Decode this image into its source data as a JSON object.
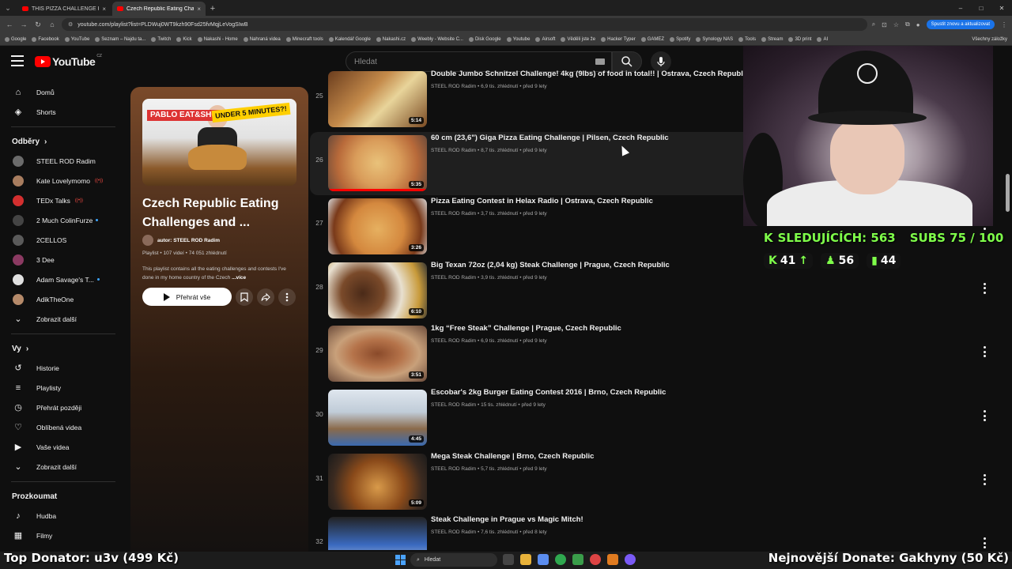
{
  "browser": {
    "tabs": [
      {
        "title": "THIS PIZZA CHALLENGE HAS O"
      },
      {
        "title": "Czech Republic Eating Challeng"
      }
    ],
    "url": "youtube.com/playlist?list=PLDWuj0WT9kzh90Fsd25fvMqjLeVogSIwB",
    "update_button": "Spustit znovu a aktualizovat",
    "bookmarks": [
      "Google",
      "Facebook",
      "YouTube",
      "Seznam – Najdu ta...",
      "Twitch",
      "Kick",
      "Nakashi - Home",
      "Nahraná videa",
      "Minecraft tools",
      "Kalendář Google",
      "Nakashi.cz",
      "Weebly - Website C...",
      "Disk Google",
      "Youtube",
      "Airsoft",
      "Věděli jste že",
      "Hacker Typer",
      "GAMEZ",
      "Spotify",
      "Synology NAS",
      "Tools",
      "Stream",
      "3D print",
      "AI"
    ],
    "bookmarks_all": "Všechny záložky"
  },
  "youtube": {
    "logo_text": "YouTube",
    "country": "CZ",
    "search_placeholder": "Hledat"
  },
  "sidebar": {
    "main": [
      {
        "label": "Domů",
        "icon": "home-icon"
      },
      {
        "label": "Shorts",
        "icon": "shorts-icon"
      }
    ],
    "subs_heading": "Odběry",
    "subscriptions": [
      {
        "label": "STEEL ROD Radim",
        "live": false,
        "new": false
      },
      {
        "label": "Kate Lovelymomo",
        "live": true,
        "new": false
      },
      {
        "label": "TEDx Talks",
        "live": true,
        "new": false
      },
      {
        "label": "2 Much ColinFurze",
        "live": false,
        "new": true
      },
      {
        "label": "2CELLOS",
        "live": false,
        "new": false
      },
      {
        "label": "3 Dee",
        "live": false,
        "new": false
      },
      {
        "label": "Adam Savage's T...",
        "live": false,
        "new": true
      },
      {
        "label": "AdikTheOne",
        "live": false,
        "new": false
      }
    ],
    "subs_more": "Zobrazit další",
    "you_heading": "Vy",
    "you_items": [
      {
        "label": "Historie",
        "icon": "history-icon"
      },
      {
        "label": "Playlisty",
        "icon": "playlists-icon"
      },
      {
        "label": "Přehrát později",
        "icon": "watch-later-icon"
      },
      {
        "label": "Oblíbená videa",
        "icon": "liked-icon"
      },
      {
        "label": "Vaše videa",
        "icon": "your-videos-icon"
      }
    ],
    "you_more": "Zobrazit další",
    "explore_heading": "Prozkoumat",
    "explore": [
      {
        "label": "Hudba",
        "icon": "music-icon"
      },
      {
        "label": "Filmy",
        "icon": "movies-icon"
      }
    ]
  },
  "playlist": {
    "thumb_logo": "PABLO EAT&SHOP",
    "thumb_badge": "UNDER 5 MINUTES?!",
    "title": "Czech Republic Eating Challenges and ...",
    "author": "autor: STEEL ROD Radim",
    "meta": "Playlist • 107 videí • 74 051 zhlédnutí",
    "description": "This playlist contains all the eating challenges and contests I've done in my home country of the Czech",
    "more": "...více",
    "play_all": "Přehrát vše"
  },
  "videos": [
    {
      "index": "25",
      "title": "Double Jumbo Schnitzel Challenge! 4kg (9lbs) of food in total!! | Ostrava, Czech Republic",
      "channel": "STEEL ROD Radim",
      "stats": "6,9 tis. zhlédnutí • před 9 lety",
      "duration": "5:14",
      "progress": 0
    },
    {
      "index": "26",
      "title": "60 cm (23,6\") Giga Pizza Eating Challenge | Pilsen, Czech Republic",
      "channel": "STEEL ROD Radim",
      "stats": "8,7 tis. zhlédnutí • před 9 lety",
      "duration": "5:35",
      "progress": 1.0
    },
    {
      "index": "27",
      "title": "Pizza Eating Contest in Helax Radio | Ostrava, Czech Republic",
      "channel": "STEEL ROD Radim",
      "stats": "3,7 tis. zhlédnutí • před 9 lety",
      "duration": "3:26",
      "progress": 0
    },
    {
      "index": "28",
      "title": "Big Texan 72oz (2,04 kg) Steak Challenge | Prague, Czech Republic",
      "channel": "STEEL ROD Radim",
      "stats": "3,9 tis. zhlédnutí • před 9 lety",
      "duration": "6:10",
      "progress": 0
    },
    {
      "index": "29",
      "title": "1kg “Free Steak” Challenge | Prague, Czech Republic",
      "channel": "STEEL ROD Radim",
      "stats": "6,9 tis. zhlédnutí • před 9 lety",
      "duration": "3:51",
      "progress": 0
    },
    {
      "index": "30",
      "title": "Escobar's 2kg Burger Eating Contest 2016 | Brno, Czech Republic",
      "channel": "STEEL ROD Radim",
      "stats": "15 tis. zhlédnutí • před 9 lety",
      "duration": "4:45",
      "progress": 0
    },
    {
      "index": "31",
      "title": "Mega Steak Challenge | Brno, Czech Republic",
      "channel": "STEEL ROD Radim",
      "stats": "5,7 tis. zhlédnutí • před 9 lety",
      "duration": "5:09",
      "progress": 0
    },
    {
      "index": "32",
      "title": "Steak Challenge in Prague vs Magic Mitch!",
      "channel": "STEEL ROD Radim",
      "stats": "7,6 tis. zhlédnutí • před 8 lety",
      "duration": "",
      "progress": 0
    }
  ],
  "stream_overlay": {
    "followers": "SLEDUJÍCÍCH: 563",
    "subs": "SUBS 75 / 100",
    "stat_kick": "41",
    "stat_users": "56",
    "stat_bars": "44",
    "top_donator": "Top Donator: u3v (499 Kč)",
    "latest_donate": "Nejnovější Donate: Gakhyny (50 Kč)"
  },
  "taskbar": {
    "search": "Hledat"
  },
  "colors": {
    "accent_green": "#7fff4a",
    "youtube_red": "#ff0000",
    "background": "#0f0f0f"
  }
}
